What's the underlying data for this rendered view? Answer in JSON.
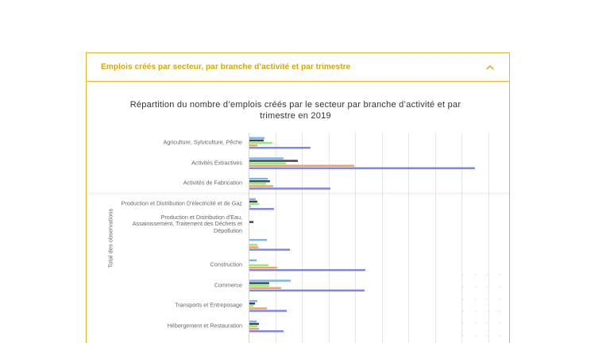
{
  "accordion": {
    "title": "Emplois créés par secteur, par branche d’activité et par trimestre",
    "state": "expanded",
    "toggle_icon": "chevron-up-icon"
  },
  "colors": {
    "accent_text": "#d6a60b",
    "accent_border": "#e4b62a"
  },
  "chart_data": {
    "type": "bar",
    "orientation": "horizontal",
    "title": "Répartition du nombre d’emplois créés par le secteur par branche d’activité et par trimestre en 2019",
    "xlabel": "Total des observations",
    "ylim": [
      0,
      9
    ],
    "grid": true,
    "categories": [
      "Agriculture, Sylviculture, Pêche",
      "Activités Extractives",
      "Activités de Fabrication",
      "Production et Distribution D'électricité et de Gaz",
      "Production et Distribution d'Eau, Assainissement, Traitement des Déchets et Dépollution",
      "",
      "Construction",
      "Commerce",
      "Transports et Entreposage",
      "Hébergement et Restauration"
    ],
    "series": [
      {
        "color": "#7cb5ec",
        "values": [
          0.57,
          1.28,
          0.69,
          0.24,
          0,
          0.66,
          0.27,
          1.55,
          0.3,
          0.27
        ]
      },
      {
        "color": "#434348",
        "values": [
          0.54,
          1.82,
          0.77,
          0.3,
          0.15,
          0,
          0,
          0.74,
          0.21,
          0.36
        ]
      },
      {
        "color": "#90ed7d",
        "values": [
          0.86,
          1.37,
          0.63,
          0.36,
          0,
          0.3,
          0.72,
          0.74,
          0.15,
          0.3
        ]
      },
      {
        "color": "#f7a35c",
        "values": [
          0.3,
          3.93,
          0.89,
          0.06,
          0,
          0.33,
          1.04,
          1.19,
          0.66,
          0.36
        ]
      },
      {
        "color": "#8085e9",
        "values": [
          2.29,
          8.46,
          3.04,
          0.92,
          0,
          1.52,
          4.35,
          4.32,
          1.4,
          1.28
        ]
      }
    ]
  }
}
